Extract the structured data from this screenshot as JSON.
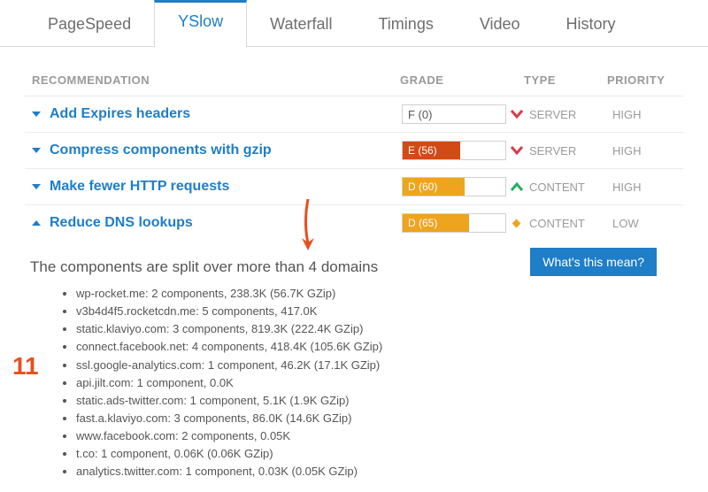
{
  "tabs": {
    "items": [
      {
        "label": "PageSpeed"
      },
      {
        "label": "YSlow"
      },
      {
        "label": "Waterfall"
      },
      {
        "label": "Timings"
      },
      {
        "label": "Video"
      },
      {
        "label": "History"
      }
    ],
    "active_index": 1
  },
  "headers": {
    "recommendation": "RECOMMENDATION",
    "grade": "GRADE",
    "type": "TYPE",
    "priority": "PRIORITY"
  },
  "rows": [
    {
      "name": "Add Expires headers",
      "grade_label": "F (0)",
      "grade_pct": 0,
      "grade_color": "#ffffff",
      "grade_plain": true,
      "trend": "down",
      "type": "SERVER",
      "priority": "HIGH",
      "expanded": false
    },
    {
      "name": "Compress components with gzip",
      "grade_label": "E (56)",
      "grade_pct": 56,
      "grade_color": "#d24a16",
      "trend": "down",
      "type": "SERVER",
      "priority": "HIGH",
      "expanded": false
    },
    {
      "name": "Make fewer HTTP requests",
      "grade_label": "D (60)",
      "grade_pct": 60,
      "grade_color": "#efa41f",
      "trend": "up",
      "type": "CONTENT",
      "priority": "HIGH",
      "expanded": false
    },
    {
      "name": "Reduce DNS lookups",
      "grade_label": "D (65)",
      "grade_pct": 65,
      "grade_color": "#efa41f",
      "trend": "diamond",
      "type": "CONTENT",
      "priority": "LOW",
      "expanded": true
    }
  ],
  "details": {
    "title": "The components are split over more than 4 domains",
    "items": [
      "wp-rocket.me: 2 components, 238.3K (56.7K GZip)",
      "v3b4d4f5.rocketcdn.me: 5 components, 417.0K",
      "static.klaviyo.com: 3 components, 819.3K (222.4K GZip)",
      "connect.facebook.net: 4 components, 418.4K (105.6K GZip)",
      "ssl.google-analytics.com: 1 component, 46.2K (17.1K GZip)",
      "api.jilt.com: 1 component, 0.0K",
      "static.ads-twitter.com: 1 component, 5.1K (1.9K GZip)",
      "fast.a.klaviyo.com: 3 components, 86.0K (14.6K GZip)",
      "www.facebook.com: 2 components, 0.05K",
      "t.co: 1 component, 0.06K (0.06K GZip)",
      "analytics.twitter.com: 1 component, 0.03K (0.05K GZip)"
    ]
  },
  "whats_button": "What's this mean?",
  "annotation_number": "11",
  "colors": {
    "trend_down": "#d63b4a",
    "trend_up": "#27ae60",
    "trend_diamond": "#efa41f"
  }
}
